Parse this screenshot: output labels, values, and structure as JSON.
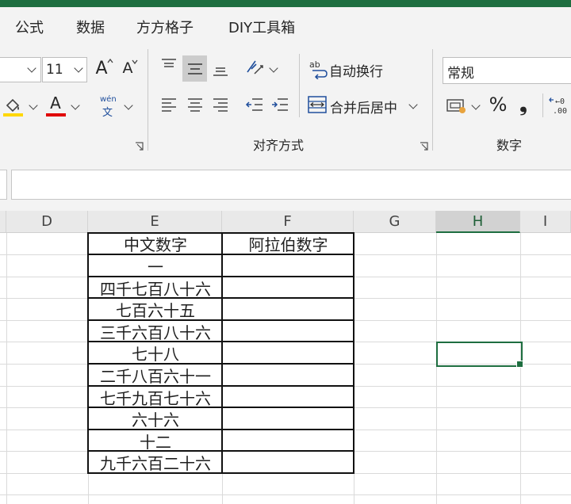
{
  "menu_tabs": [
    "公式",
    "数据",
    "方方格子",
    "DIY工具箱"
  ],
  "font": {
    "size_value": "11",
    "grow_label": "A",
    "shrink_label": "A",
    "font_color_label": "A",
    "phonetic_top": "wén",
    "phonetic_bottom": "文",
    "underline_colors": {
      "fill": "#ffd700",
      "font": "#e00000"
    }
  },
  "alignment": {
    "wrap_text_label": "自动换行",
    "merge_center_label": "合并后居中",
    "wrap_icon_text": "ab",
    "group_label": "对齐方式"
  },
  "number": {
    "format_value": "常规",
    "percent_label": "%",
    "comma_label": "❟",
    "group_label": "数字"
  },
  "column_headers": [
    "D",
    "E",
    "F",
    "G",
    "H",
    "I"
  ],
  "active_column": "H",
  "table": {
    "headers": [
      "中文数字",
      "阿拉伯数字"
    ],
    "rows": [
      [
        "一",
        ""
      ],
      [
        "四千七百八十六",
        ""
      ],
      [
        "七百六十五",
        ""
      ],
      [
        "三千六百八十六",
        ""
      ],
      [
        "七十八",
        ""
      ],
      [
        "二千八百六十一",
        ""
      ],
      [
        "七千九百七十六",
        ""
      ],
      [
        "六十六",
        ""
      ],
      [
        "十二",
        ""
      ],
      [
        "九千六百二十六",
        ""
      ]
    ]
  },
  "colors": {
    "accent": "#1e6e40",
    "ribbon_bg": "#f3f3f3"
  }
}
